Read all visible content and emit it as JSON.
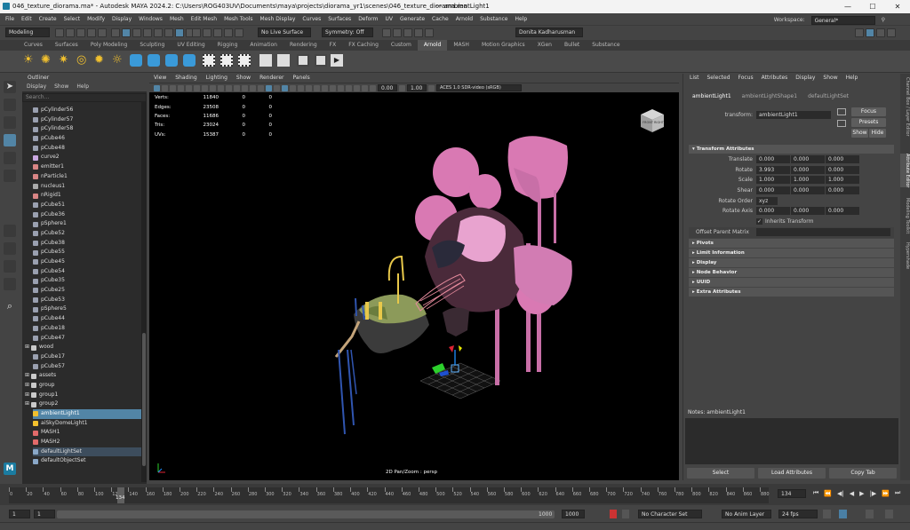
{
  "titlebar": {
    "title": "046_texture_diorama.ma* - Autodesk MAYA 2024.2: C:\\Users\\ROG403UV\\Documents\\maya\\projects\\diorama_yr1\\scenes\\046_texture_diorama.ma",
    "center": "---   ambientLight1",
    "minimize": "—",
    "maximize": "☐",
    "close": "✕"
  },
  "menubar": {
    "items": [
      "File",
      "Edit",
      "Create",
      "Select",
      "Modify",
      "Display",
      "Windows",
      "Mesh",
      "Edit Mesh",
      "Mesh Tools",
      "Mesh Display",
      "Curves",
      "Surfaces",
      "Deform",
      "UV",
      "Generate",
      "Cache",
      "Arnold",
      "Substance",
      "Help"
    ],
    "workspace_label": "Workspace:",
    "workspace_value": "General*"
  },
  "statusline": {
    "mode": "Modeling",
    "live_surface": "No Live Surface",
    "symmetry": "Symmetry: Off",
    "user": "Donita Kadharusman"
  },
  "shelf_tabs": [
    "Curves",
    "Surfaces",
    "Poly Modeling",
    "Sculpting",
    "UV Editing",
    "Rigging",
    "Animation",
    "Rendering",
    "FX",
    "FX Caching",
    "Custom",
    "Arnold",
    "MASH",
    "Motion Graphics",
    "XGen",
    "Bullet",
    "Substance"
  ],
  "shelf_active": "Arnold",
  "outliner": {
    "title": "Outliner",
    "menus": [
      "Display",
      "Show",
      "Help"
    ],
    "search_placeholder": "Search...",
    "items": [
      {
        "label": "pCylinder56",
        "icon": "mesh-icon"
      },
      {
        "label": "pCylinder57",
        "icon": "mesh-icon"
      },
      {
        "label": "pCylinder58",
        "icon": "mesh-icon"
      },
      {
        "label": "pCube46",
        "icon": "mesh-icon"
      },
      {
        "label": "pCube48",
        "icon": "mesh-icon"
      },
      {
        "label": "curve2",
        "icon": "curve-icon"
      },
      {
        "label": "emitter1",
        "icon": "emitter-icon"
      },
      {
        "label": "nParticle1",
        "icon": "particle-icon"
      },
      {
        "label": "nucleus1",
        "icon": "nucleus-icon"
      },
      {
        "label": "nRigid1",
        "icon": "rigid-icon"
      },
      {
        "label": "pCube51",
        "icon": "mesh-icon"
      },
      {
        "label": "pCube36",
        "icon": "mesh-icon"
      },
      {
        "label": "pSphere1",
        "icon": "mesh-icon"
      },
      {
        "label": "pCube52",
        "icon": "mesh-icon"
      },
      {
        "label": "pCube38",
        "icon": "mesh-icon"
      },
      {
        "label": "pCube55",
        "icon": "mesh-icon"
      },
      {
        "label": "pCube45",
        "icon": "mesh-icon"
      },
      {
        "label": "pCube54",
        "icon": "mesh-icon"
      },
      {
        "label": "pCube35",
        "icon": "mesh-icon"
      },
      {
        "label": "pCube25",
        "icon": "mesh-icon"
      },
      {
        "label": "pCube53",
        "icon": "mesh-icon"
      },
      {
        "label": "pSphere5",
        "icon": "mesh-icon"
      },
      {
        "label": "pCube44",
        "icon": "mesh-icon"
      },
      {
        "label": "pCube18",
        "icon": "mesh-icon"
      },
      {
        "label": "pCube47",
        "icon": "mesh-icon"
      },
      {
        "label": "wood",
        "icon": "group-icon",
        "expand": true
      },
      {
        "label": "pCube17",
        "icon": "mesh-icon"
      },
      {
        "label": "pCube57",
        "icon": "mesh-icon"
      },
      {
        "label": "assets",
        "icon": "group-icon",
        "expand": true
      },
      {
        "label": "group",
        "icon": "group-icon",
        "expand": true
      },
      {
        "label": "group1",
        "icon": "group-icon",
        "expand": true
      },
      {
        "label": "group2",
        "icon": "group-icon",
        "expand": true
      },
      {
        "label": "ambientLight1",
        "icon": "light-icon",
        "selected": true
      },
      {
        "label": "aiSkyDomeLight1",
        "icon": "light-icon"
      },
      {
        "label": "MASH1",
        "icon": "mash-icon"
      },
      {
        "label": "MASH2",
        "icon": "mash-icon"
      },
      {
        "label": "defaultLightSet",
        "icon": "set-icon",
        "dim": true
      },
      {
        "label": "defaultObjectSet",
        "icon": "set-icon"
      }
    ]
  },
  "viewport": {
    "menus": [
      "View",
      "Shading",
      "Lighting",
      "Show",
      "Renderer",
      "Panels"
    ],
    "exposure": "0.00",
    "gamma": "1.00",
    "color_space": "ACES 1.0 SDR-video (sRGB)",
    "hud": [
      {
        "k": "Verts:",
        "v": "11840",
        "a": "0",
        "b": "0"
      },
      {
        "k": "Edges:",
        "v": "23508",
        "a": "0",
        "b": "0"
      },
      {
        "k": "Faces:",
        "v": "11686",
        "a": "0",
        "b": "0"
      },
      {
        "k": "Tris:",
        "v": "23024",
        "a": "0",
        "b": "0"
      },
      {
        "k": "UVs:",
        "v": "15387",
        "a": "0",
        "b": "0"
      }
    ],
    "camera_label": "2D Pan/Zoom : persp",
    "viewcube_front": "FRONT",
    "viewcube_right": "RIGHT"
  },
  "attribute_editor": {
    "menus": [
      "List",
      "Selected",
      "Focus",
      "Attributes",
      "Display",
      "Show",
      "Help"
    ],
    "tabs": [
      "ambientLight1",
      "ambientLightShape1",
      "defaultLightSet"
    ],
    "transform_label": "transform:",
    "transform_value": "ambientLight1",
    "focus": "Focus",
    "presets": "Presets",
    "show": "Show",
    "hide": "Hide",
    "section_transform": "Transform Attributes",
    "translate_label": "Translate",
    "translate": [
      "0.000",
      "0.000",
      "0.000"
    ],
    "rotate_label": "Rotate",
    "rotate": [
      "3.993",
      "0.000",
      "0.000"
    ],
    "scale_label": "Scale",
    "scale": [
      "1.000",
      "1.000",
      "1.000"
    ],
    "shear_label": "Shear",
    "shear": [
      "0.000",
      "0.000",
      "0.000"
    ],
    "rotate_order_label": "Rotate Order",
    "rotate_order": "xyz",
    "rotate_axis_label": "Rotate Axis",
    "rotate_axis": [
      "0.000",
      "0.000",
      "0.000"
    ],
    "inherits": "Inherits Transform",
    "offset_parent": "Offset Parent Matrix",
    "sections": [
      "Pivots",
      "Limit Information",
      "Display",
      "Node Behavior",
      "UUID",
      "Extra Attributes"
    ],
    "notes": "Notes:  ambientLight1",
    "select_btn": "Select",
    "load_btn": "Load Attributes",
    "copy_btn": "Copy Tab"
  },
  "side_tabs": [
    "Channel Box / Layer Editor",
    "Attribute Editor",
    "Modeling Toolkit",
    "Hypershade"
  ],
  "timeslider": {
    "ticks": [
      "0",
      "20",
      "40",
      "60",
      "80",
      "100",
      "120",
      "140",
      "160",
      "180",
      "200",
      "220",
      "240",
      "260",
      "280",
      "300",
      "320",
      "340",
      "360",
      "380",
      "400",
      "420",
      "440",
      "460",
      "480",
      "500",
      "520",
      "540",
      "560",
      "580",
      "600",
      "620",
      "640",
      "660",
      "680",
      "700",
      "720",
      "740",
      "760",
      "780",
      "800",
      "820",
      "840",
      "860",
      "880"
    ],
    "current": "134",
    "current_field": "134"
  },
  "range": {
    "start": "1",
    "start_inner": "1",
    "end_inner": "1000",
    "end": "1000",
    "character_set": "No Character Set",
    "anim_layer": "No Anim Layer",
    "fps": "24 fps"
  },
  "colors": {
    "selection": "#5285a6",
    "pink": "#d977b4",
    "key": "#d04040"
  }
}
